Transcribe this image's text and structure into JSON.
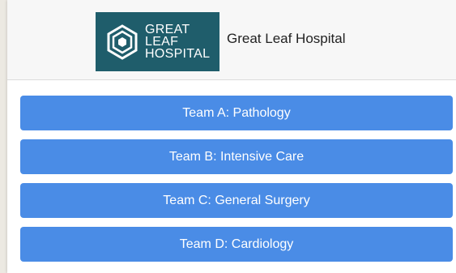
{
  "header": {
    "logo_lines": [
      "GREAT",
      "LEAF",
      "HOSPITAL"
    ],
    "hospital_name": "Great Leaf Hospital"
  },
  "colors": {
    "logo_bg": "#1f5d6b",
    "button_bg": "#4a8ce6",
    "button_text": "#ffffff"
  },
  "teams": [
    {
      "label": "Team A: Pathology"
    },
    {
      "label": "Team B: Intensive Care"
    },
    {
      "label": "Team C: General Surgery"
    },
    {
      "label": "Team D: Cardiology"
    }
  ]
}
